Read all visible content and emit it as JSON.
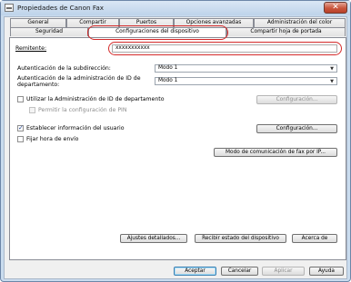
{
  "window": {
    "title": "Propiedades de Canon Fax",
    "close_glyph": "✕"
  },
  "tabs_back": [
    "General",
    "Compartir",
    "Puertos",
    "Opciones avanzadas",
    "Administración del color"
  ],
  "tabs_front": [
    "Seguridad",
    "Configuraciones del dispositivo",
    "Compartir hoja de portada"
  ],
  "sender": {
    "label": "Remitente:",
    "value": "xxxxxxxxxxx"
  },
  "subaddress_auth": {
    "label": "Autenticación de la subdirección:",
    "value": "Modo 1"
  },
  "dept_auth": {
    "label_line1": "Autenticación de la administración de ID de",
    "label_line2": "departamento:",
    "value": "Modo 1"
  },
  "dept_admin": {
    "label": "Utilizar la Administración de ID de departamento",
    "checked": false,
    "button": "Configuración..."
  },
  "allow_pin": {
    "label": "Permitir la configuración de PIN",
    "checked": false
  },
  "user_info": {
    "label": "Establecer información del usuario",
    "checked": true,
    "button": "Configuración..."
  },
  "send_time": {
    "label": "Fijar hora de envío",
    "checked": false
  },
  "ip_fax_button": "Modo de comunicación de fax por IP...",
  "bottom_buttons": {
    "details": "Ajustes detallados...",
    "get_status": "Recibir estado del dispositivo",
    "about": "Acerca de"
  },
  "dialog_buttons": {
    "ok": "Aceptar",
    "cancel": "Cancelar",
    "apply": "Aplicar",
    "help": "Ayuda"
  },
  "icons": {
    "app": "fax-app-icon",
    "close": "close-icon",
    "dropdown": "chevron-down-icon",
    "check": "checkmark-icon"
  },
  "colors": {
    "highlight": "#d42a2a",
    "titlebar": "#c9dbee"
  }
}
